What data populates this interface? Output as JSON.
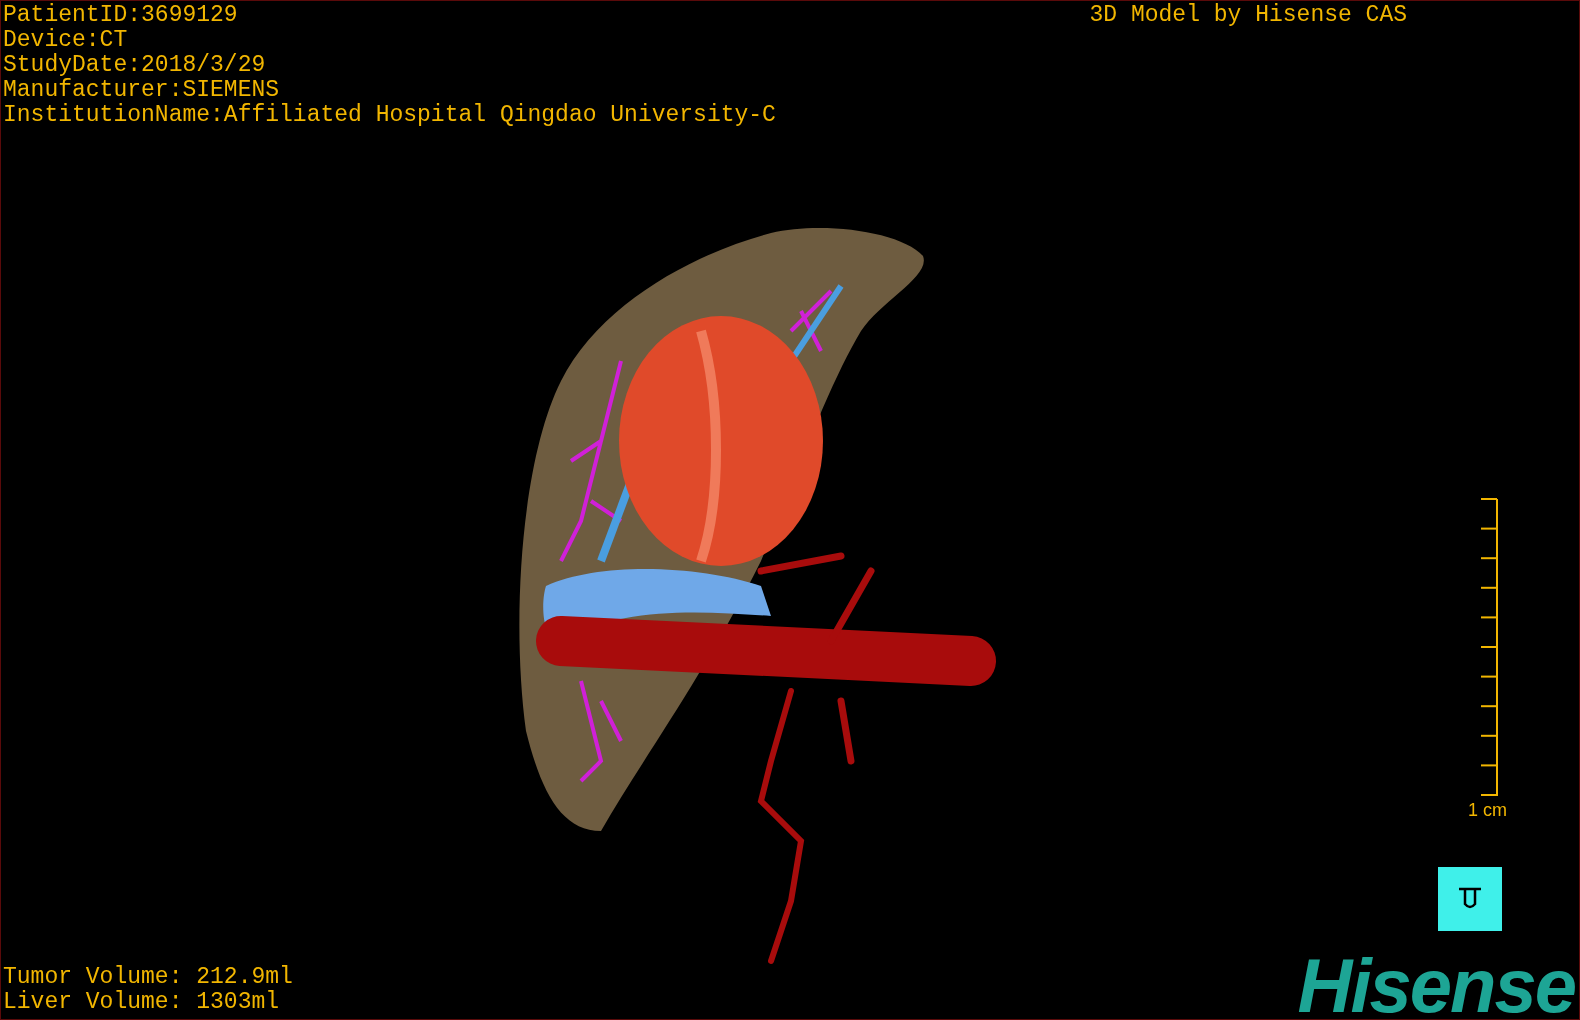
{
  "study_info": [
    "PatientID:3699129",
    "Device:CT",
    "StudyDate:2018/3/29",
    "Manufacturer:SIEMENS",
    "InstitutionName:Affiliated Hospital Qingdao University-C"
  ],
  "title": "3D Model by Hisense CAS",
  "scale_bar": {
    "label": "1 cm"
  },
  "volumes": [
    "Tumor Volume: 212.9ml",
    "Liver Volume: 1303ml"
  ],
  "logo": "Hisense"
}
